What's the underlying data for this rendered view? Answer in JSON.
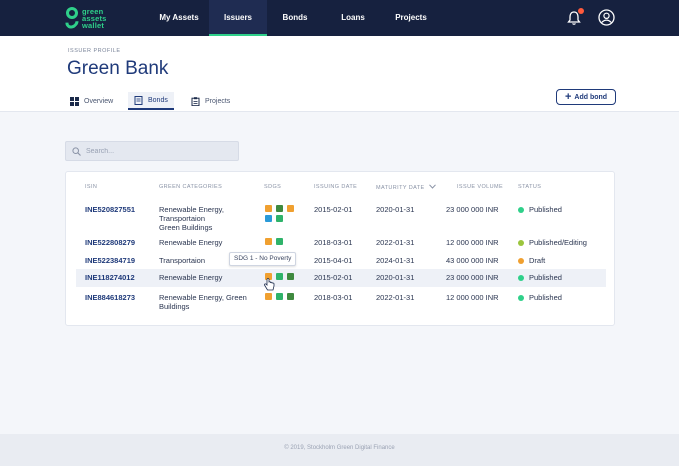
{
  "nav": {
    "logo_lines": [
      "green",
      "assets",
      "wallet"
    ],
    "items": [
      {
        "label": "My Assets",
        "active": false
      },
      {
        "label": "Issuers",
        "active": true
      },
      {
        "label": "Bonds",
        "active": false
      },
      {
        "label": "Loans",
        "active": false
      },
      {
        "label": "Projects",
        "active": false
      }
    ],
    "icons": [
      "bell-icon",
      "user-circle-icon"
    ],
    "notification_color": "#ff5a3c"
  },
  "header": {
    "eyebrow": "ISSUER PROFILE",
    "title": "Green Bank",
    "tabs": [
      {
        "label": "Overview",
        "icon": "grid-icon",
        "active": false
      },
      {
        "label": "Bonds",
        "icon": "document-icon",
        "active": true
      },
      {
        "label": "Projects",
        "icon": "clipboard-icon",
        "active": false
      }
    ],
    "add_button": "Add bond"
  },
  "search": {
    "placeholder": "Search..."
  },
  "table": {
    "columns": [
      "ISIN",
      "GREEN CATEGORIES",
      "SDGS",
      "ISSUING DATE",
      "MATURITY DATE",
      "ISSUE VOLUME",
      "STATUS"
    ],
    "sort_column": "MATURITY DATE",
    "rows": [
      {
        "isin": "INE520827551",
        "categories": [
          "Renewable Energy,",
          "Transportaion",
          "Green Buildings"
        ],
        "sdgs": [
          "#f0a030",
          "#3f8a3f",
          "#f0a030",
          "#2a9ad8",
          "#2fb36a"
        ],
        "issuing": "2015-02-01",
        "maturity": "2020-01-31",
        "volume": "23 000 000 INR",
        "status": "Published",
        "status_color": "#2fd08a"
      },
      {
        "isin": "INE522808279",
        "categories": [
          "Renewable Energy"
        ],
        "sdgs": [
          "#f0a030",
          "#2fb36a"
        ],
        "issuing": "2018-03-01",
        "maturity": "2022-01-31",
        "volume": "12 000 000 INR",
        "status": "Published/Editing",
        "status_color": "#9bc53d"
      },
      {
        "isin": "INE522384719",
        "categories": [
          "Transportaion"
        ],
        "sdgs": [
          "#2fb36a"
        ],
        "issuing": "2015-04-01",
        "maturity": "2024-01-31",
        "volume": "43 000 000 INR",
        "status": "Draft",
        "status_color": "#f0a030"
      },
      {
        "isin": "INE118274012",
        "categories": [
          "Renewable Energy"
        ],
        "sdgs": [
          "#f0a030",
          "#2fb36a",
          "#3f8a3f"
        ],
        "issuing": "2015-02-01",
        "maturity": "2020-01-31",
        "volume": "23 000 000 INR",
        "status": "Published",
        "status_color": "#2fd08a"
      },
      {
        "isin": "INE884618273",
        "categories": [
          "Renewable Energy, Green",
          "Buildings"
        ],
        "sdgs": [
          "#f0a030",
          "#2fb36a",
          "#3f8a3f"
        ],
        "issuing": "2018-03-01",
        "maturity": "2022-01-31",
        "volume": "12 000 000 INR",
        "status": "Published",
        "status_color": "#2fd08a"
      }
    ]
  },
  "tooltip": "SDG 1 - No Poverty",
  "footer": "© 2019, Stockholm Green Digital Finance",
  "colors": {
    "nav_bg": "#16213f",
    "accent_green": "#2fd08a",
    "primary_blue": "#1f3a7a"
  }
}
